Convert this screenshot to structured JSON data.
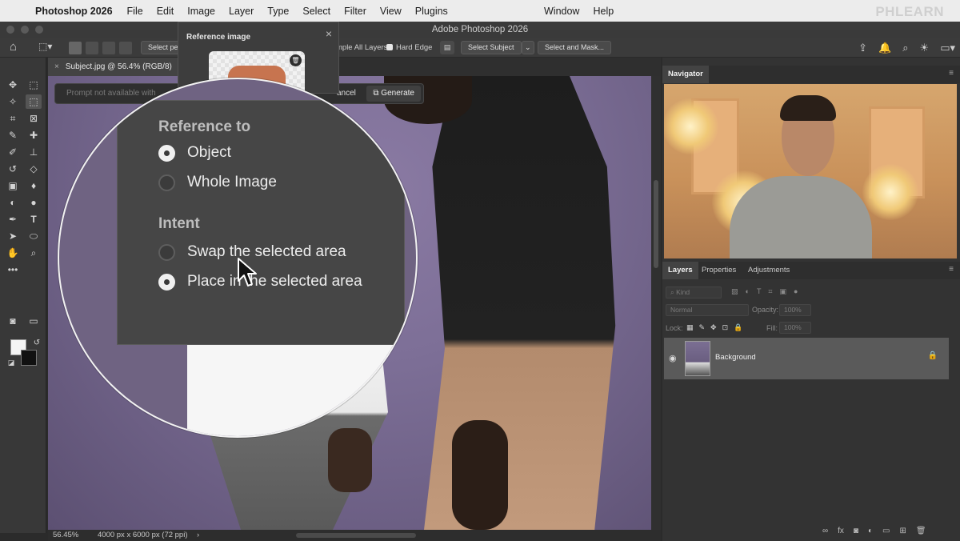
{
  "menubar": {
    "app_name": "Photoshop 2026",
    "items": [
      "File",
      "Edit",
      "Image",
      "Layer",
      "Type",
      "Select",
      "Filter",
      "View",
      "Plugins"
    ],
    "right_items": [
      "Window",
      "Help"
    ],
    "brand": "PHLEARN"
  },
  "window": {
    "title": "Adobe Photoshop 2026"
  },
  "options_bar": {
    "select_label": "Select pe",
    "sample_all_layers": "mple All Layers",
    "hard_edge": "Hard Edge",
    "select_subject": "Select Subject",
    "select_and_mask": "Select and Mask..."
  },
  "document": {
    "tab_label": "Subject.jpg @ 56.4% (RGB/8)",
    "zoom": "56.45%",
    "dimensions": "4000 px x 6000 px (72 ppi)"
  },
  "gen_fill": {
    "prompt_placeholder": "Prompt not available with",
    "cancel_label": "ancel",
    "generate_label": "Generate"
  },
  "reference_popup": {
    "title": "Reference image"
  },
  "reference_options": {
    "section_reference": "Reference to",
    "option_object": "Object",
    "option_whole": "Whole Image",
    "section_intent": "Intent",
    "option_swap": "Swap the selected area",
    "option_place": "Place in the selected area",
    "selected_reference": "Object",
    "selected_intent": "Place in the selected area"
  },
  "navigator": {
    "tab": "Navigator"
  },
  "layers_panel": {
    "tabs": [
      "Layers",
      "Properties",
      "Adjustments"
    ],
    "kind_placeholder": "Kind",
    "blend_mode": "Normal",
    "opacity_label": "Opacity:",
    "opacity_value": "100%",
    "lock_label": "Lock:",
    "fill_label": "Fill:",
    "fill_value": "100%",
    "layer_name": "Background"
  },
  "colors": {
    "menubar_bg": "#ececec",
    "panel_bg": "#333333",
    "selected_layer_bg": "#5a5a5a",
    "magnifier_border": "#f2f2f2"
  }
}
